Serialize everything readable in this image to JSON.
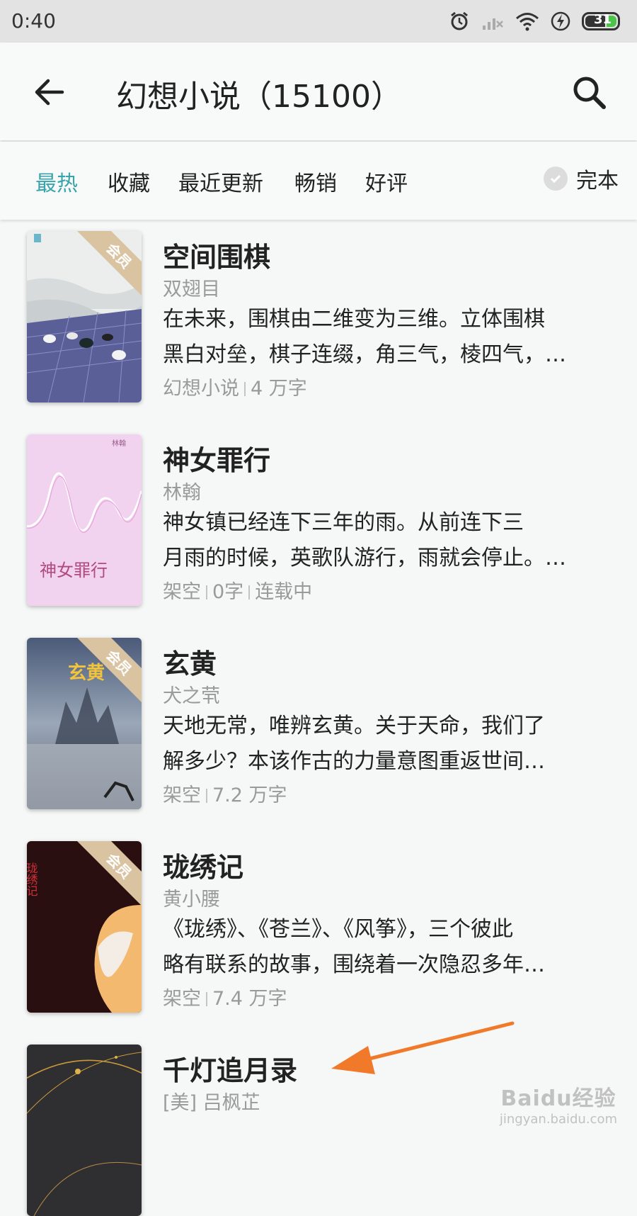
{
  "status_bar": {
    "time": "0:40",
    "battery": "31"
  },
  "header": {
    "title": "幻想小说（15100）"
  },
  "filters": {
    "tabs": [
      {
        "label": "最热",
        "active": true
      },
      {
        "label": "收藏",
        "active": false
      },
      {
        "label": "最近更新",
        "active": false
      },
      {
        "label": "畅销",
        "active": false
      },
      {
        "label": "好评",
        "active": false
      }
    ],
    "complete_label": "完本"
  },
  "books": [
    {
      "title": "空间围棋",
      "author": "双翅目",
      "desc_line1": "在未来，围棋由二维变为三维。立体围棋",
      "desc_line2": "黑白对垒，棋子连缀，角三气，棱四气，…",
      "meta": [
        "幻想小说",
        "4 万字"
      ],
      "vip": "会员"
    },
    {
      "title": "神女罪行",
      "author": "林翰",
      "desc_line1": "神女镇已经连下三年的雨。从前连下三",
      "desc_line2": "月雨的时候，英歌队游行，雨就会停止。…",
      "meta": [
        "架空",
        "0字",
        "连载中"
      ],
      "cover_text": "神女罪行",
      "cover_author": "林翰"
    },
    {
      "title": "玄黄",
      "author": "犬之茕",
      "desc_line1": "天地无常，唯辨玄黄。关于天命，我们了",
      "desc_line2": "解多少？本该作古的力量意图重返世间…",
      "meta": [
        "架空",
        "7.2 万字"
      ],
      "vip": "会员",
      "cover_text": "玄黄"
    },
    {
      "title": "珑绣记",
      "author": "黄小腰",
      "desc_line1": "《珑绣》、《苍兰》、《风筝》，三个彼此",
      "desc_line2": "略有联系的故事，围绕着一次隐忍多年…",
      "meta": [
        "架空",
        "7.4 万字"
      ],
      "vip": "会员",
      "cover_text": "珑绣记"
    },
    {
      "title": "千灯追月录",
      "author": "[美] 吕枫芷"
    }
  ],
  "annotation": {
    "color": "#f07a2a"
  },
  "watermark": {
    "main": "Baidu经验",
    "sub": "jingyan.baidu.com"
  }
}
